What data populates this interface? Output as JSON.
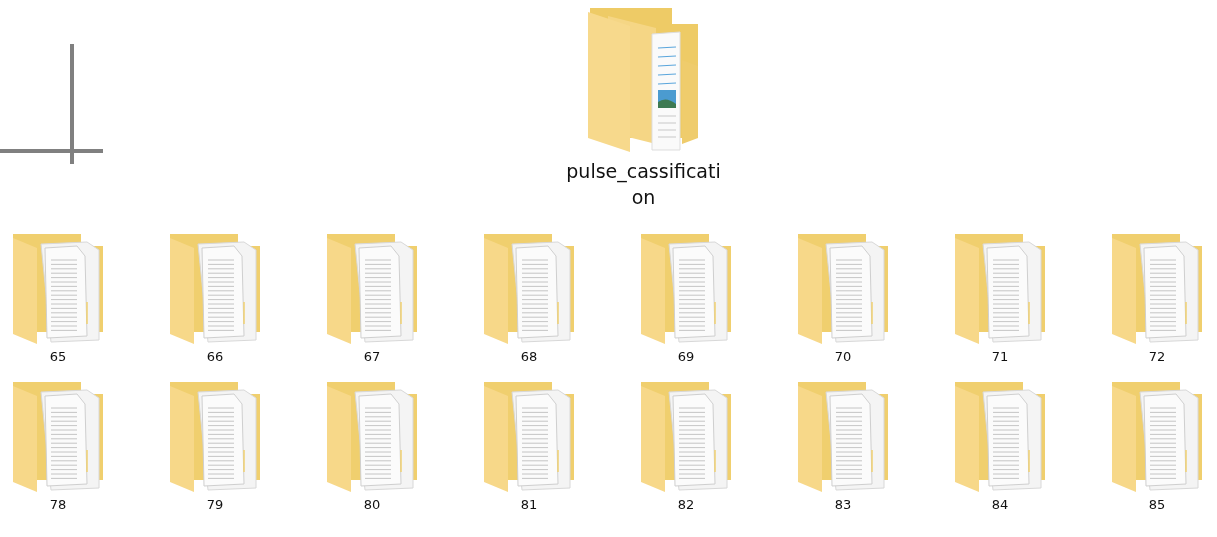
{
  "top_folder": {
    "name": "pulse_cassification"
  },
  "folders": [
    {
      "name": "65"
    },
    {
      "name": "66"
    },
    {
      "name": "67"
    },
    {
      "name": "68"
    },
    {
      "name": "69"
    },
    {
      "name": "70"
    },
    {
      "name": "71"
    },
    {
      "name": "72"
    },
    {
      "name": "78"
    },
    {
      "name": "79"
    },
    {
      "name": "80"
    },
    {
      "name": "81"
    },
    {
      "name": "82"
    },
    {
      "name": "83"
    },
    {
      "name": "84"
    },
    {
      "name": "85"
    }
  ]
}
